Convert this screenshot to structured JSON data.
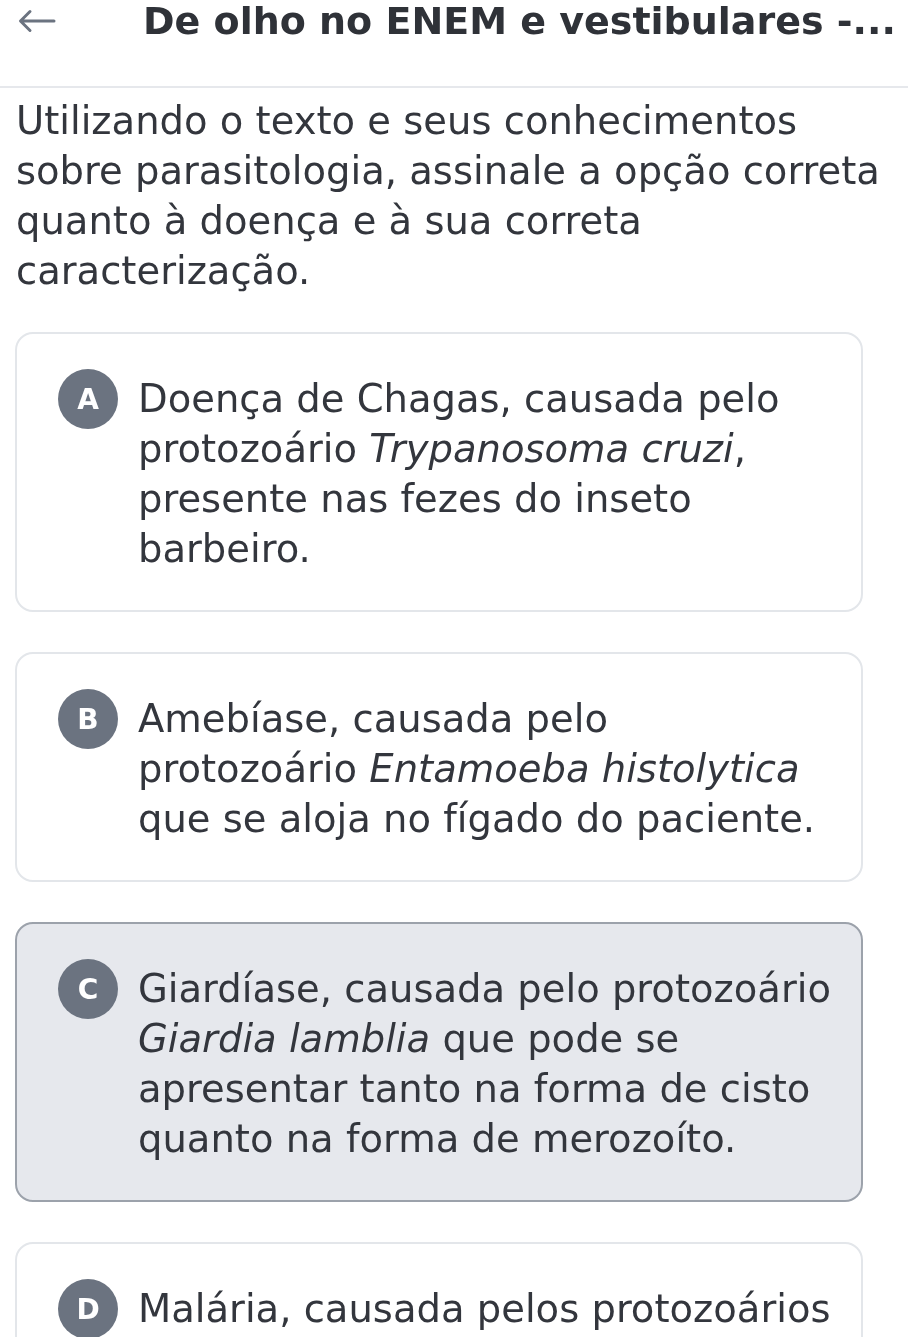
{
  "header": {
    "title": "De olho no ENEM e vestibulares -..."
  },
  "question": {
    "text": "Utilizando o texto e seus conhecimentos sobre parasitologia, assinale a opção correta quanto à doença e à sua correta caracterização."
  },
  "options": [
    {
      "letter": "A",
      "text": "Doença de Chagas, causada pelo protozoário *Trypanosoma cruzi*, presente nas fezes do inseto barbeiro.",
      "selected": false
    },
    {
      "letter": "B",
      "text": "Amebíase, causada pelo protozoário *Entamoeba histolytica* que se aloja no fígado do paciente.",
      "selected": false
    },
    {
      "letter": "C",
      "text": "Giardíase, causada pelo protozoário *Giardia lamblia* que pode se apresentar tanto na forma de cisto quanto na forma de merozoíto.",
      "selected": true
    },
    {
      "letter": "D",
      "text": "Malária, causada pelos protozoários",
      "selected": false
    }
  ]
}
